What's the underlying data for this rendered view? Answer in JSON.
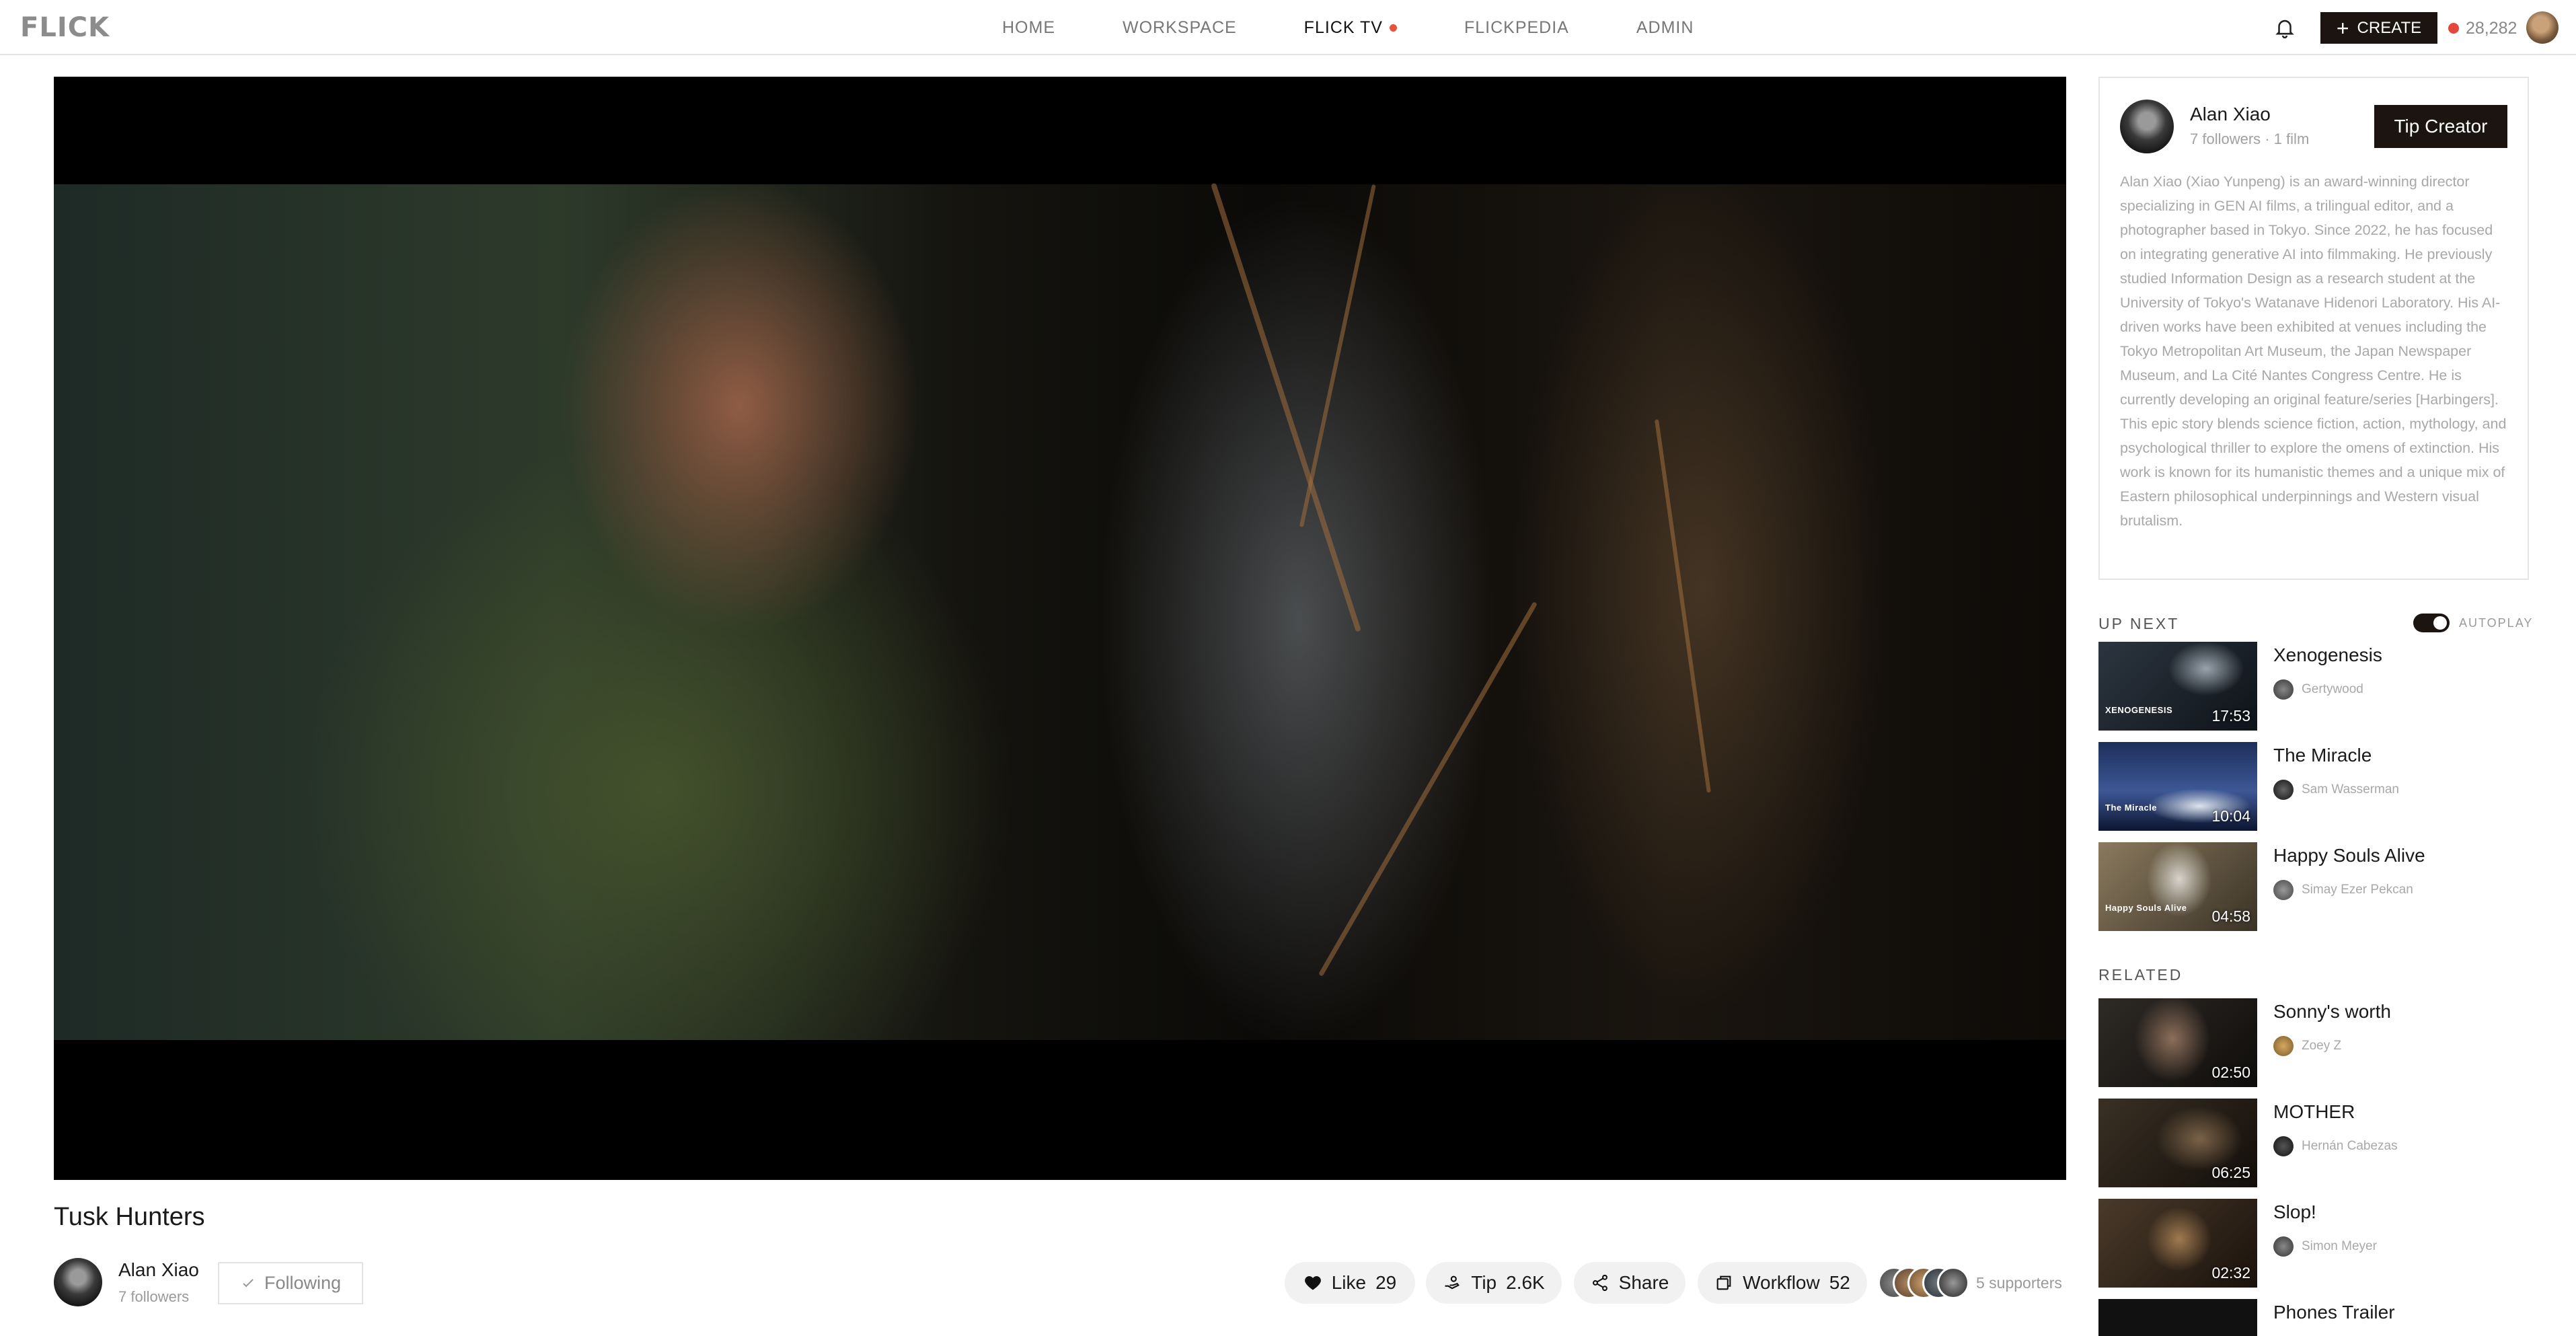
{
  "nav": {
    "logo": "FLICK",
    "links": [
      {
        "label": "HOME"
      },
      {
        "label": "WORKSPACE"
      },
      {
        "label": "FLICK TV"
      },
      {
        "label": "FLICKPEDIA"
      },
      {
        "label": "ADMIN"
      }
    ],
    "create_label": "CREATE",
    "credits": "28,282"
  },
  "video": {
    "title": "Tusk Hunters",
    "creator": {
      "name": "Alan Xiao",
      "followers": "7 followers"
    },
    "following_label": "Following",
    "actions": {
      "like_label": "Like",
      "like_count": "29",
      "tip_label": "Tip",
      "tip_count": "2.6K",
      "share_label": "Share",
      "workflow_label": "Workflow",
      "workflow_count": "52"
    },
    "supporters": "5 supporters"
  },
  "creator_card": {
    "name": "Alan Xiao",
    "meta": "7 followers · 1 film",
    "tip_label": "Tip Creator",
    "bio": "Alan Xiao (Xiao Yunpeng) is an award-winning director specializing in GEN AI films, a trilingual editor, and a photographer based in Tokyo. Since 2022, he has focused on integrating generative AI into filmmaking. He previously studied Information Design as a research student at the University of Tokyo's Watanave Hidenori Laboratory. His AI-driven works have been exhibited at venues including the Tokyo Metropolitan Art Museum, the Japan Newspaper Museum, and La Cité Nantes Congress Centre. He is currently developing an original feature/series [Harbingers]. This epic story blends science fiction, action, mythology, and psychological thriller to explore the omens of extinction. His work is known for its humanistic themes and a unique mix of Eastern philosophical underpinnings and Western visual brutalism."
  },
  "up_next": {
    "label": "UP NEXT",
    "autoplay_label": "AUTOPLAY",
    "autoplay_on": true,
    "items": [
      {
        "title": "Xenogenesis",
        "author": "Gertywood",
        "duration": "17:53",
        "thumb_text": "XENOGENESIS"
      },
      {
        "title": "The Miracle",
        "author": "Sam Wasserman",
        "duration": "10:04",
        "thumb_text": "The Miracle"
      },
      {
        "title": "Happy Souls Alive",
        "author": "Simay Ezer Pekcan",
        "duration": "04:58",
        "thumb_text": "Happy Souls Alive"
      }
    ]
  },
  "related": {
    "label": "RELATED",
    "items": [
      {
        "title": "Sonny's worth",
        "author": "Zoey Z",
        "duration": "02:50"
      },
      {
        "title": "MOTHER",
        "author": "Hernán Cabezas",
        "duration": "06:25"
      },
      {
        "title": "Slop!",
        "author": "Simon Meyer",
        "duration": "02:32"
      },
      {
        "title": "Phones Trailer",
        "author": "",
        "duration": ""
      }
    ]
  },
  "colors": {
    "accent_dark": "#1b1410",
    "live_dot": "#e8523c"
  }
}
